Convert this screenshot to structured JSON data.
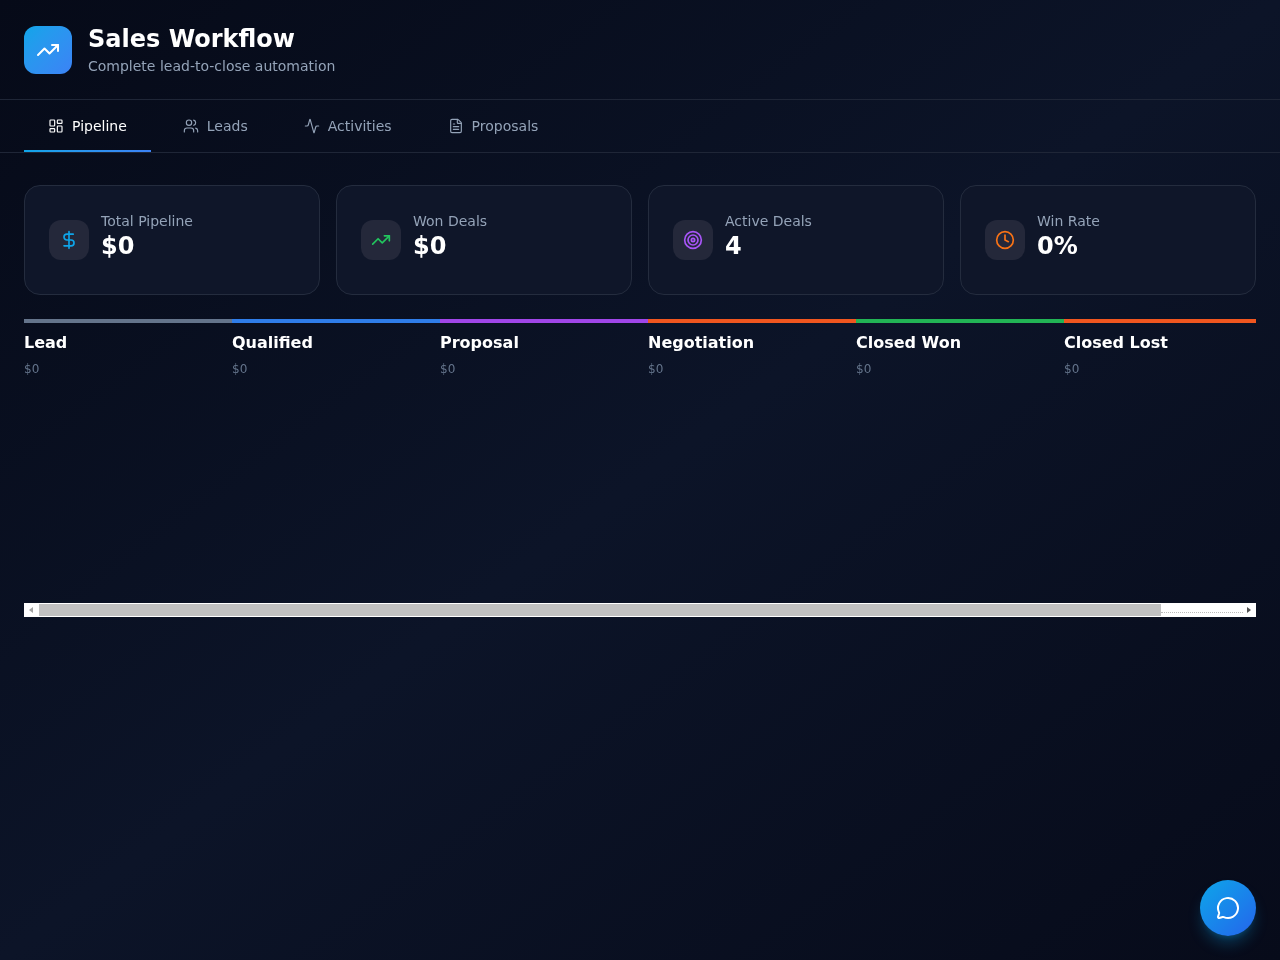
{
  "header": {
    "title": "Sales Workflow",
    "subtitle": "Complete lead-to-close automation"
  },
  "tabs": [
    {
      "label": "Pipeline",
      "selected": true
    },
    {
      "label": "Leads",
      "selected": false
    },
    {
      "label": "Activities",
      "selected": false
    },
    {
      "label": "Proposals",
      "selected": false
    }
  ],
  "stats": [
    {
      "label": "Total Pipeline",
      "value": "$0",
      "color": "#0ea5e9"
    },
    {
      "label": "Won Deals",
      "value": "$0",
      "color": "#22c55e"
    },
    {
      "label": "Active Deals",
      "value": "4",
      "color": "#a855f7"
    },
    {
      "label": "Win Rate",
      "value": "0%",
      "color": "#f97316"
    }
  ],
  "stages": [
    {
      "name": "Lead",
      "amount": "$0",
      "color": "#64748b"
    },
    {
      "name": "Qualified",
      "amount": "$0",
      "color": "#2f7de9"
    },
    {
      "name": "Proposal",
      "amount": "$0",
      "color": "#a046e8"
    },
    {
      "name": "Negotiation",
      "amount": "$0",
      "color": "#f0561f"
    },
    {
      "name": "Closed Won",
      "amount": "$0",
      "color": "#22b455"
    },
    {
      "name": "Closed Lost",
      "amount": "$0",
      "color": "#f0561f"
    }
  ]
}
